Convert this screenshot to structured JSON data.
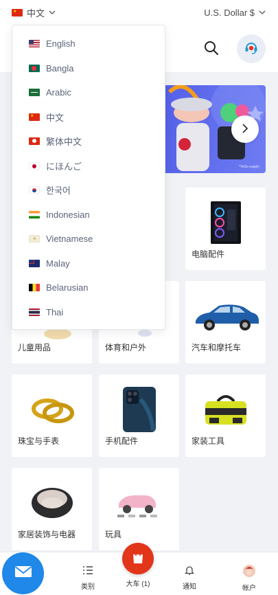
{
  "topbar": {
    "language_label": "中文",
    "currency_label": "U.S. Dollar $"
  },
  "banner": {
    "credit": "*TeGo supply"
  },
  "language_menu": [
    {
      "label": "English",
      "flag": "us"
    },
    {
      "label": "Bangla",
      "flag": "bd"
    },
    {
      "label": "Arabic",
      "flag": "sa"
    },
    {
      "label": "中文",
      "flag": "cn"
    },
    {
      "label": "繁体中文",
      "flag": "hk"
    },
    {
      "label": "にほんご",
      "flag": "jp"
    },
    {
      "label": "한국어",
      "flag": "kr"
    },
    {
      "label": "Indonesian",
      "flag": "in"
    },
    {
      "label": "Vietnamese",
      "flag": "vn"
    },
    {
      "label": "Malay",
      "flag": "my"
    },
    {
      "label": "Belarusian",
      "flag": "be"
    },
    {
      "label": "Thai",
      "flag": "th"
    }
  ],
  "categories": [
    {
      "label": "电脑配件"
    },
    {
      "label": "儿童用品"
    },
    {
      "label": "体育和户外"
    },
    {
      "label": "汽车和摩托车"
    },
    {
      "label": "珠宝与手表"
    },
    {
      "label": "手机配件"
    },
    {
      "label": "家装工具"
    },
    {
      "label": "家居装饰与电器"
    },
    {
      "label": "玩具"
    }
  ],
  "bottom_nav": {
    "categories": "类别",
    "cart": "大车 (1)",
    "notifications": "通知",
    "account": "帐户"
  },
  "colors": {
    "accent_red": "#e2361b",
    "mail_blue": "#1f88e8",
    "banner_purple": "#5b52e4"
  }
}
